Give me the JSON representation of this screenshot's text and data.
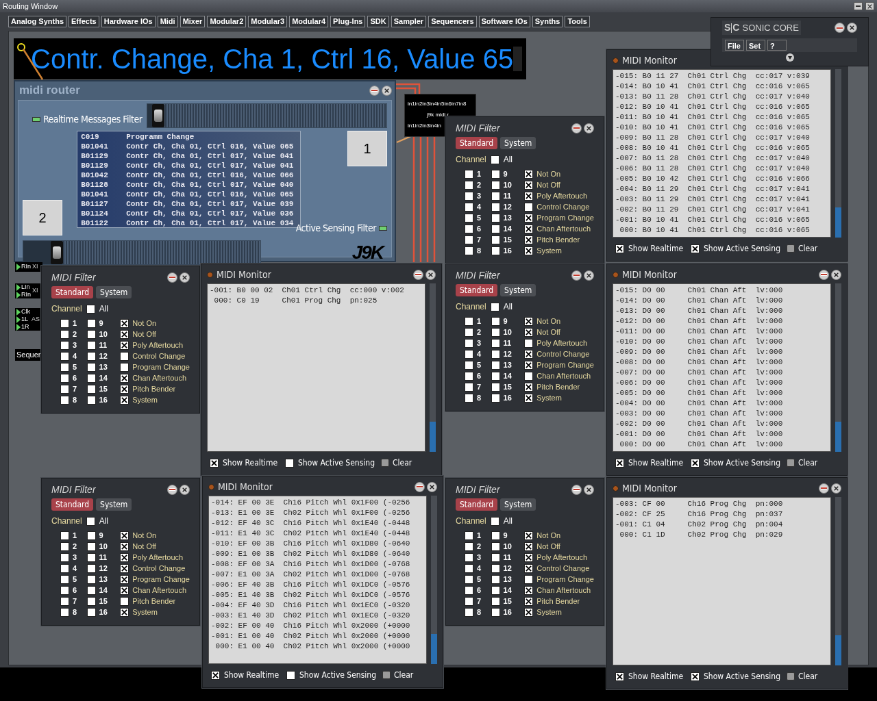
{
  "window": {
    "title": "Routing Window"
  },
  "menu_tabs": [
    "Analog Synths",
    "Effects",
    "Hardware IOs",
    "Midi",
    "Mixer",
    "Modular2",
    "Modular3",
    "Modular4",
    "Plug-Ins",
    "SDK",
    "Sampler",
    "Sequencers",
    "Software IOs",
    "Synths",
    "Tools"
  ],
  "display": {
    "text": "Contr. Change, Cha 1, Ctrl 16, Value 65"
  },
  "midi_router": {
    "title": "midi router",
    "realtime_filter": {
      "label": "Realtime Messages Filter",
      "on": true
    },
    "top_slider": {
      "level": 0.02
    },
    "log": [
      "C019      Programm Change",
      "B01041    Contr Ch, Cha 01, Ctrl 016, Value 065",
      "B01129    Contr Ch, Cha 01, Ctrl 017, Value 041",
      "B01129    Contr Ch, Cha 01, Ctrl 017, Value 041",
      "B01042    Contr Ch, Cha 01, Ctrl 016, Value 066",
      "B01128    Contr Ch, Cha 01, Ctrl 017, Value 040",
      "B01041    Contr Ch, Cha 01, Ctrl 016, Value 065",
      "B01127    Contr Ch, Cha 01, Ctrl 017, Value 039",
      "B01124    Contr Ch, Cha 01, Ctrl 017, Value 036",
      "B01122    Contr Ch, Cha 01, Ctrl 017, Value 034"
    ],
    "button_1": "1",
    "button_2": "2",
    "active_sensing_filter": {
      "label": "Active Sensing Filter",
      "on": true
    },
    "bottom_slider": {
      "level": 0.12
    },
    "logo": "J9K"
  },
  "router_node": {
    "inputs": "in1in2in3in4in5in6in7in8",
    "name": "j9k midi r",
    "outputs": "in1in2in3in4in"
  },
  "side_modules": [
    {
      "lines": [
        "RIn"
      ],
      "tag": "XI"
    },
    {
      "lines": [
        "LIn",
        "RIn"
      ],
      "tag": "XI"
    },
    {
      "lines": [
        "Clk",
        "1L",
        "1R"
      ],
      "tag": "AS"
    },
    {
      "lines": [
        "Sequer"
      ]
    }
  ],
  "sonic_core": {
    "logo": [
      "S",
      "C"
    ],
    "brand": "SONIC CORE",
    "menu": [
      "File",
      "Set",
      "?"
    ]
  },
  "filters": [
    {
      "title": "MIDI Filter",
      "tabs": [
        {
          "label": "Standard",
          "selected": true
        },
        {
          "label": "System",
          "selected": false
        }
      ],
      "channel_label": "Channel",
      "all": {
        "label": "All",
        "checked": false
      },
      "channels": [
        {
          "label": "1",
          "checked": false
        },
        {
          "label": "2",
          "checked": false
        },
        {
          "label": "3",
          "checked": false
        },
        {
          "label": "4",
          "checked": false
        },
        {
          "label": "5",
          "checked": false
        },
        {
          "label": "6",
          "checked": false
        },
        {
          "label": "7",
          "checked": false
        },
        {
          "label": "8",
          "checked": false
        },
        {
          "label": "9",
          "checked": false
        },
        {
          "label": "10",
          "checked": false
        },
        {
          "label": "11",
          "checked": false
        },
        {
          "label": "12",
          "checked": false
        },
        {
          "label": "13",
          "checked": false
        },
        {
          "label": "14",
          "checked": false
        },
        {
          "label": "15",
          "checked": false
        },
        {
          "label": "16",
          "checked": false
        }
      ],
      "messages": [
        {
          "label": "Not On",
          "checked": true
        },
        {
          "label": "Not Off",
          "checked": true
        },
        {
          "label": "Poly Aftertouch",
          "checked": true
        },
        {
          "label": "Control Change",
          "checked": false
        },
        {
          "label": "Program Change",
          "checked": true
        },
        {
          "label": "Chan Aftertouch",
          "checked": true
        },
        {
          "label": "Pitch Bender",
          "checked": true
        },
        {
          "label": "System",
          "checked": true
        }
      ]
    },
    {
      "title": "MIDI Filter",
      "tabs": [
        {
          "label": "Standard",
          "selected": true
        },
        {
          "label": "System",
          "selected": false
        }
      ],
      "channel_label": "Channel",
      "all": {
        "label": "All",
        "checked": false
      },
      "channels": [
        {
          "label": "1",
          "checked": false
        },
        {
          "label": "2",
          "checked": false
        },
        {
          "label": "3",
          "checked": false
        },
        {
          "label": "4",
          "checked": false
        },
        {
          "label": "5",
          "checked": false
        },
        {
          "label": "6",
          "checked": false
        },
        {
          "label": "7",
          "checked": false
        },
        {
          "label": "8",
          "checked": false
        },
        {
          "label": "9",
          "checked": false
        },
        {
          "label": "10",
          "checked": false
        },
        {
          "label": "11",
          "checked": false
        },
        {
          "label": "12",
          "checked": false
        },
        {
          "label": "13",
          "checked": false
        },
        {
          "label": "14",
          "checked": false
        },
        {
          "label": "15",
          "checked": false
        },
        {
          "label": "16",
          "checked": false
        }
      ],
      "messages": [
        {
          "label": "Not On",
          "checked": true
        },
        {
          "label": "Not Off",
          "checked": true
        },
        {
          "label": "Poly Aftertouch",
          "checked": true
        },
        {
          "label": "Control Change",
          "checked": false
        },
        {
          "label": "Program Change",
          "checked": false
        },
        {
          "label": "Chan Aftertouch",
          "checked": true
        },
        {
          "label": "Pitch Bender",
          "checked": true
        },
        {
          "label": "System",
          "checked": true
        }
      ]
    },
    {
      "title": "MIDI Filter",
      "tabs": [
        {
          "label": "Standard",
          "selected": true
        },
        {
          "label": "System",
          "selected": false
        }
      ],
      "channel_label": "Channel",
      "all": {
        "label": "All",
        "checked": false
      },
      "channels": [
        {
          "label": "1",
          "checked": false
        },
        {
          "label": "2",
          "checked": false
        },
        {
          "label": "3",
          "checked": false
        },
        {
          "label": "4",
          "checked": false
        },
        {
          "label": "5",
          "checked": false
        },
        {
          "label": "6",
          "checked": false
        },
        {
          "label": "7",
          "checked": false
        },
        {
          "label": "8",
          "checked": false
        },
        {
          "label": "9",
          "checked": false
        },
        {
          "label": "10",
          "checked": false
        },
        {
          "label": "11",
          "checked": false
        },
        {
          "label": "12",
          "checked": false
        },
        {
          "label": "13",
          "checked": false
        },
        {
          "label": "14",
          "checked": false
        },
        {
          "label": "15",
          "checked": false
        },
        {
          "label": "16",
          "checked": false
        }
      ],
      "messages": [
        {
          "label": "Not On",
          "checked": true
        },
        {
          "label": "Not Off",
          "checked": true
        },
        {
          "label": "Poly Aftertouch",
          "checked": false
        },
        {
          "label": "Control Change",
          "checked": true
        },
        {
          "label": "Program Change",
          "checked": true
        },
        {
          "label": "Chan Aftertouch",
          "checked": false
        },
        {
          "label": "Pitch Bender",
          "checked": true
        },
        {
          "label": "System",
          "checked": true
        }
      ]
    },
    {
      "title": "MIDI Filter",
      "tabs": [
        {
          "label": "Standard",
          "selected": true
        },
        {
          "label": "System",
          "selected": false
        }
      ],
      "channel_label": "Channel",
      "all": {
        "label": "All",
        "checked": false
      },
      "channels": [
        {
          "label": "1",
          "checked": false
        },
        {
          "label": "2",
          "checked": false
        },
        {
          "label": "3",
          "checked": false
        },
        {
          "label": "4",
          "checked": false
        },
        {
          "label": "5",
          "checked": false
        },
        {
          "label": "6",
          "checked": false
        },
        {
          "label": "7",
          "checked": false
        },
        {
          "label": "8",
          "checked": false
        },
        {
          "label": "9",
          "checked": false
        },
        {
          "label": "10",
          "checked": false
        },
        {
          "label": "11",
          "checked": false
        },
        {
          "label": "12",
          "checked": false
        },
        {
          "label": "13",
          "checked": false
        },
        {
          "label": "14",
          "checked": false
        },
        {
          "label": "15",
          "checked": false
        },
        {
          "label": "16",
          "checked": false
        }
      ],
      "messages": [
        {
          "label": "Not On",
          "checked": true
        },
        {
          "label": "Not Off",
          "checked": true
        },
        {
          "label": "Poly Aftertouch",
          "checked": true
        },
        {
          "label": "Control Change",
          "checked": true
        },
        {
          "label": "Program Change",
          "checked": true
        },
        {
          "label": "Chan Aftertouch",
          "checked": true
        },
        {
          "label": "Pitch Bender",
          "checked": false
        },
        {
          "label": "System",
          "checked": true
        }
      ]
    },
    {
      "title": "MIDI Filter",
      "tabs": [
        {
          "label": "Standard",
          "selected": true
        },
        {
          "label": "System",
          "selected": false
        }
      ],
      "channel_label": "Channel",
      "all": {
        "label": "All",
        "checked": false
      },
      "channels": [
        {
          "label": "1",
          "checked": false
        },
        {
          "label": "2",
          "checked": false
        },
        {
          "label": "3",
          "checked": false
        },
        {
          "label": "4",
          "checked": false
        },
        {
          "label": "5",
          "checked": false
        },
        {
          "label": "6",
          "checked": false
        },
        {
          "label": "7",
          "checked": false
        },
        {
          "label": "8",
          "checked": false
        },
        {
          "label": "9",
          "checked": false
        },
        {
          "label": "10",
          "checked": false
        },
        {
          "label": "11",
          "checked": false
        },
        {
          "label": "12",
          "checked": false
        },
        {
          "label": "13",
          "checked": false
        },
        {
          "label": "14",
          "checked": false
        },
        {
          "label": "15",
          "checked": false
        },
        {
          "label": "16",
          "checked": false
        }
      ],
      "messages": [
        {
          "label": "Not On",
          "checked": true
        },
        {
          "label": "Not Off",
          "checked": true
        },
        {
          "label": "Poly Aftertouch",
          "checked": true
        },
        {
          "label": "Control Change",
          "checked": true
        },
        {
          "label": "Program Change",
          "checked": false
        },
        {
          "label": "Chan Aftertouch",
          "checked": true
        },
        {
          "label": "Pitch Bender",
          "checked": true
        },
        {
          "label": "System",
          "checked": true
        }
      ]
    }
  ],
  "monitors": [
    {
      "title": "MIDI Monitor",
      "rows": [
        "-015: B0 11 27  Ch01 Ctrl Chg  cc:017 v:039",
        "-014: B0 10 41  Ch01 Ctrl Chg  cc:016 v:065",
        "-013: B0 11 28  Ch01 Ctrl Chg  cc:017 v:040",
        "-012: B0 10 41  Ch01 Ctrl Chg  cc:016 v:065",
        "-011: B0 10 41  Ch01 Ctrl Chg  cc:016 v:065",
        "-010: B0 10 41  Ch01 Ctrl Chg  cc:016 v:065",
        "-009: B0 11 28  Ch01 Ctrl Chg  cc:017 v:040",
        "-008: B0 10 41  Ch01 Ctrl Chg  cc:016 v:065",
        "-007: B0 11 28  Ch01 Ctrl Chg  cc:017 v:040",
        "-006: B0 11 28  Ch01 Ctrl Chg  cc:017 v:040",
        "-005: B0 10 42  Ch01 Ctrl Chg  cc:016 v:066",
        "-004: B0 11 29  Ch01 Ctrl Chg  cc:017 v:041",
        "-003: B0 11 29  Ch01 Ctrl Chg  cc:017 v:041",
        "-002: B0 11 29  Ch01 Ctrl Chg  cc:017 v:041",
        "-001: B0 10 41  Ch01 Ctrl Chg  cc:016 v:065",
        " 000: B0 10 41  Ch01 Ctrl Chg  cc:016 v:065"
      ],
      "show_realtime": {
        "label": "Show Realtime",
        "checked": true
      },
      "show_active_sensing": {
        "label": "Show Active Sensing",
        "checked": true
      },
      "clear": "Clear"
    },
    {
      "title": "MIDI Monitor",
      "rows": [
        "-001: B0 00 02  Ch01 Ctrl Chg  cc:000 v:002",
        " 000: C0 19     Ch01 Prog Chg  pn:025"
      ],
      "show_realtime": {
        "label": "Show Realtime",
        "checked": true
      },
      "show_active_sensing": {
        "label": "Show Active Sensing",
        "checked": false
      },
      "clear": "Clear"
    },
    {
      "title": "MIDI Monitor",
      "rows": [
        "-015: D0 00     Ch01 Chan Aft  lv:000",
        "-014: D0 00     Ch01 Chan Aft  lv:000",
        "-013: D0 00     Ch01 Chan Aft  lv:000",
        "-012: D0 00     Ch01 Chan Aft  lv:000",
        "-011: D0 00     Ch01 Chan Aft  lv:000",
        "-010: D0 00     Ch01 Chan Aft  lv:000",
        "-009: D0 00     Ch01 Chan Aft  lv:000",
        "-008: D0 00     Ch01 Chan Aft  lv:000",
        "-007: D0 00     Ch01 Chan Aft  lv:000",
        "-006: D0 00     Ch01 Chan Aft  lv:000",
        "-005: D0 00     Ch01 Chan Aft  lv:000",
        "-004: D0 00     Ch01 Chan Aft  lv:000",
        "-003: D0 00     Ch01 Chan Aft  lv:000",
        "-002: D0 00     Ch01 Chan Aft  lv:000",
        "-001: D0 00     Ch01 Chan Aft  lv:000",
        " 000: D0 00     Ch01 Chan Aft  lv:000"
      ],
      "show_realtime": {
        "label": "Show Realtime",
        "checked": true
      },
      "show_active_sensing": {
        "label": "Show Active Sensing",
        "checked": true
      },
      "clear": "Clear"
    },
    {
      "title": "MIDI Monitor",
      "rows": [
        "-014: EF 00 3E  Ch16 Pitch Whl 0x1F00 (-0256",
        "-013: E1 00 3E  Ch02 Pitch Whl 0x1F00 (-0256",
        "-012: EF 40 3C  Ch16 Pitch Whl 0x1E40 (-0448",
        "-011: E1 40 3C  Ch02 Pitch Whl 0x1E40 (-0448",
        "-010: EF 00 3B  Ch16 Pitch Whl 0x1D80 (-0640",
        "-009: E1 00 3B  Ch02 Pitch Whl 0x1D80 (-0640",
        "-008: EF 00 3A  Ch16 Pitch Whl 0x1D00 (-0768",
        "-007: E1 00 3A  Ch02 Pitch Whl 0x1D00 (-0768",
        "-006: EF 40 3B  Ch16 Pitch Whl 0x1DC0 (-0576",
        "-005: E1 40 3B  Ch02 Pitch Whl 0x1DC0 (-0576",
        "-004: EF 40 3D  Ch16 Pitch Whl 0x1EC0 (-0320",
        "-003: E1 40 3D  Ch02 Pitch Whl 0x1EC0 (-0320",
        "-002: EF 00 40  Ch16 Pitch Whl 0x2000 (+0000",
        "-001: E1 00 40  Ch02 Pitch Whl 0x2000 (+0000",
        " 000: E1 00 40  Ch02 Pitch Whl 0x2000 (+0000"
      ],
      "show_realtime": {
        "label": "Show Realtime",
        "checked": true
      },
      "show_active_sensing": {
        "label": "Show Active Sensing",
        "checked": false
      },
      "clear": "Clear"
    },
    {
      "title": "MIDI Monitor",
      "rows": [
        "-003: CF 00     Ch16 Prog Chg  pn:000",
        "-002: CF 25     Ch16 Prog Chg  pn:037",
        "-001: C1 04     Ch02 Prog Chg  pn:004",
        " 000: C1 1D     Ch02 Prog Chg  pn:029"
      ],
      "show_realtime": {
        "label": "Show Realtime",
        "checked": true
      },
      "show_active_sensing": {
        "label": "Show Active Sensing",
        "checked": true
      },
      "clear": "Clear"
    }
  ]
}
